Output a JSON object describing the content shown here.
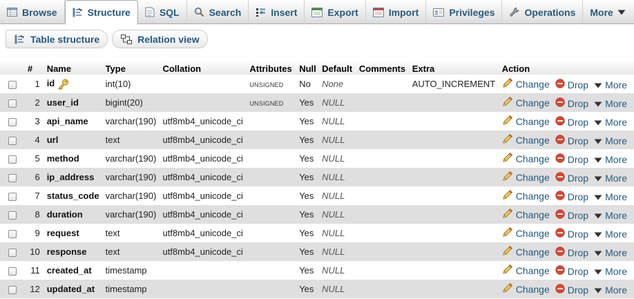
{
  "tabs": [
    {
      "label": "Browse",
      "icon": "browse-icon",
      "active": false
    },
    {
      "label": "Structure",
      "icon": "structure-icon",
      "active": true
    },
    {
      "label": "SQL",
      "icon": "sql-icon",
      "active": false
    },
    {
      "label": "Search",
      "icon": "search-icon",
      "active": false
    },
    {
      "label": "Insert",
      "icon": "insert-icon",
      "active": false
    },
    {
      "label": "Export",
      "icon": "export-icon",
      "active": false
    },
    {
      "label": "Import",
      "icon": "import-icon",
      "active": false
    },
    {
      "label": "Privileges",
      "icon": "privileges-icon",
      "active": false
    },
    {
      "label": "Operations",
      "icon": "wrench-icon",
      "active": false
    },
    {
      "label": "More",
      "icon": "triangle-down-icon",
      "active": false
    }
  ],
  "subtabs": [
    {
      "label": "Table structure",
      "icon": "structure-icon"
    },
    {
      "label": "Relation view",
      "icon": "relation-icon"
    }
  ],
  "table": {
    "headers": [
      "",
      "#",
      "Name",
      "Type",
      "Collation",
      "Attributes",
      "Null",
      "Default",
      "Comments",
      "Extra",
      "Action"
    ],
    "actions": {
      "change": "Change",
      "drop": "Drop",
      "more": "More"
    },
    "rows": [
      {
        "num": "1",
        "name": "id",
        "primary_key": true,
        "type": "int(10)",
        "collation": "",
        "attributes": "UNSIGNED",
        "null": "No",
        "default": "None",
        "comments": "",
        "extra": "AUTO_INCREMENT"
      },
      {
        "num": "2",
        "name": "user_id",
        "primary_key": false,
        "type": "bigint(20)",
        "collation": "",
        "attributes": "UNSIGNED",
        "null": "Yes",
        "default": "NULL",
        "comments": "",
        "extra": ""
      },
      {
        "num": "3",
        "name": "api_name",
        "primary_key": false,
        "type": "varchar(190)",
        "collation": "utf8mb4_unicode_ci",
        "attributes": "",
        "null": "Yes",
        "default": "NULL",
        "comments": "",
        "extra": ""
      },
      {
        "num": "4",
        "name": "url",
        "primary_key": false,
        "type": "text",
        "collation": "utf8mb4_unicode_ci",
        "attributes": "",
        "null": "Yes",
        "default": "NULL",
        "comments": "",
        "extra": ""
      },
      {
        "num": "5",
        "name": "method",
        "primary_key": false,
        "type": "varchar(190)",
        "collation": "utf8mb4_unicode_ci",
        "attributes": "",
        "null": "Yes",
        "default": "NULL",
        "comments": "",
        "extra": ""
      },
      {
        "num": "6",
        "name": "ip_address",
        "primary_key": false,
        "type": "varchar(190)",
        "collation": "utf8mb4_unicode_ci",
        "attributes": "",
        "null": "Yes",
        "default": "NULL",
        "comments": "",
        "extra": ""
      },
      {
        "num": "7",
        "name": "status_code",
        "primary_key": false,
        "type": "varchar(190)",
        "collation": "utf8mb4_unicode_ci",
        "attributes": "",
        "null": "Yes",
        "default": "NULL",
        "comments": "",
        "extra": ""
      },
      {
        "num": "8",
        "name": "duration",
        "primary_key": false,
        "type": "varchar(190)",
        "collation": "utf8mb4_unicode_ci",
        "attributes": "",
        "null": "Yes",
        "default": "NULL",
        "comments": "",
        "extra": ""
      },
      {
        "num": "9",
        "name": "request",
        "primary_key": false,
        "type": "text",
        "collation": "utf8mb4_unicode_ci",
        "attributes": "",
        "null": "Yes",
        "default": "NULL",
        "comments": "",
        "extra": ""
      },
      {
        "num": "10",
        "name": "response",
        "primary_key": false,
        "type": "text",
        "collation": "utf8mb4_unicode_ci",
        "attributes": "",
        "null": "Yes",
        "default": "NULL",
        "comments": "",
        "extra": ""
      },
      {
        "num": "11",
        "name": "created_at",
        "primary_key": false,
        "type": "timestamp",
        "collation": "",
        "attributes": "",
        "null": "Yes",
        "default": "NULL",
        "comments": "",
        "extra": ""
      },
      {
        "num": "12",
        "name": "updated_at",
        "primary_key": false,
        "type": "timestamp",
        "collation": "",
        "attributes": "",
        "null": "Yes",
        "default": "NULL",
        "comments": "",
        "extra": ""
      }
    ]
  },
  "colors": {
    "link": "#235a81",
    "row_even": "#dfdfdf",
    "drop_red": "#e0452f",
    "pencil": "#e8b84a"
  }
}
